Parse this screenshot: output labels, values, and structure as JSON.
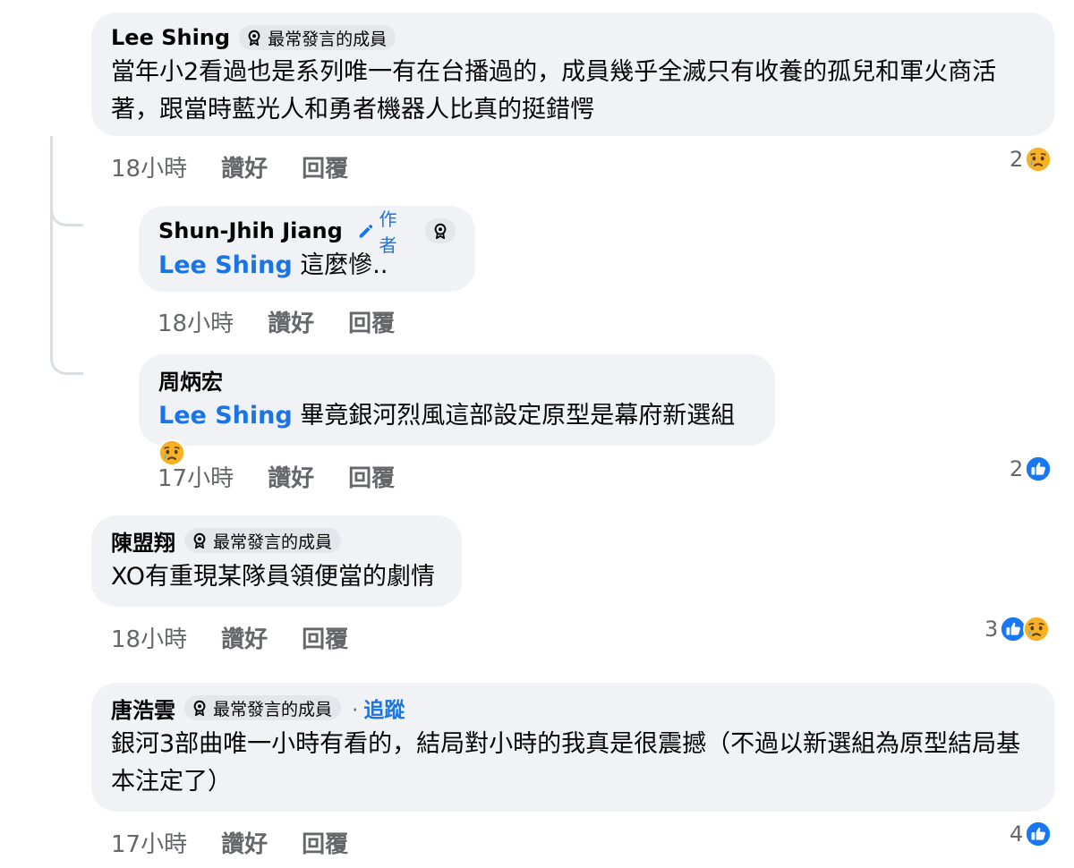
{
  "comments": [
    {
      "name": "Lee Shing",
      "badge": "最常發言的成員",
      "text": "當年小2看過也是系列唯一有在台播過的，成員幾乎全滅只有收養的孤兒和軍火商活著，跟當時藍光人和勇者機器人比真的挺錯愕",
      "time": "18小時",
      "like": "讚好",
      "reply": "回覆",
      "reaction_count": "2"
    },
    {
      "name": "Shun-Jhih Jiang",
      "author_label": "作者",
      "mention": "Lee Shing",
      "text": "這麼慘..",
      "time": "18小時",
      "like": "讚好",
      "reply": "回覆"
    },
    {
      "name": "周炳宏",
      "mention": "Lee Shing",
      "text": "畢竟銀河烈風這部設定原型是幕府新選組",
      "time": "17小時",
      "like": "讚好",
      "reply": "回覆",
      "reaction_count": "2"
    },
    {
      "name": "陳盟翔",
      "badge": "最常發言的成員",
      "text": "XO有重現某隊員領便當的劇情",
      "time": "18小時",
      "like": "讚好",
      "reply": "回覆",
      "reaction_count": "3"
    },
    {
      "name": "唐浩雲",
      "badge": "最常發言的成員",
      "follow": "追蹤",
      "text": "銀河3部曲唯一小時有看的，結局對小時的我真是很震撼（不過以新選組為原型結局基本注定了）",
      "time": "17小時",
      "like": "讚好",
      "reply": "回覆",
      "reaction_count": "4"
    }
  ],
  "icons": {
    "badge": "award-icon",
    "author": "pencil-icon",
    "like_reaction": "like-reaction-icon",
    "sad_reaction": "sad-reaction-icon"
  },
  "colors": {
    "bubble": "#f0f2f5",
    "link": "#1b74e4",
    "meta": "#65676b",
    "like_blue": "#1877f2",
    "sad_yellow": "#f7b125"
  }
}
